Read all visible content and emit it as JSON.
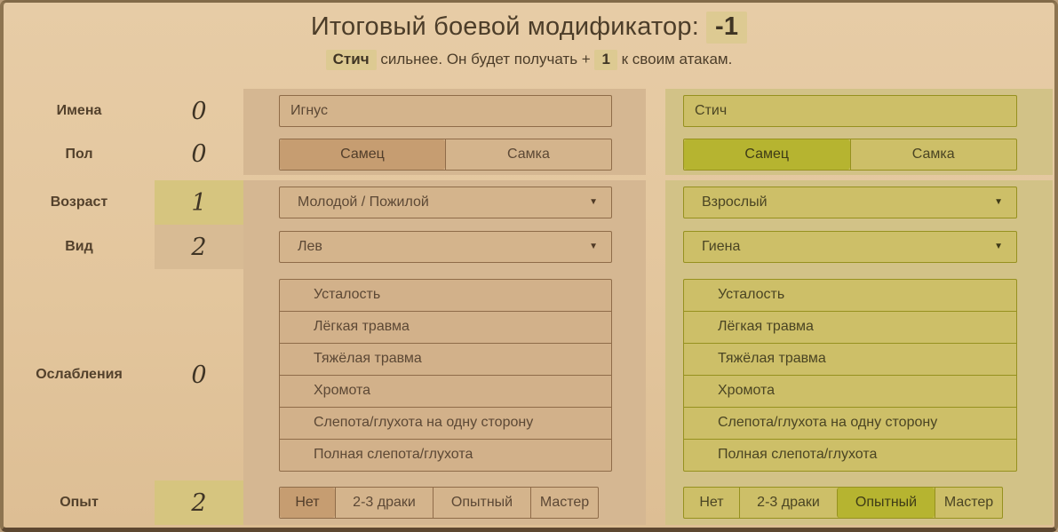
{
  "theme": {
    "left_accent": "#c69d71",
    "right_accent": "#b6b430",
    "highlight_badge": "#ddca92",
    "left_panel": "#d5b792",
    "right_panel": "#d2c287",
    "score_highlight_left": "#d8bb94",
    "score_highlight_right": "#d6c57f"
  },
  "header": {
    "title": "Итоговый боевой модификатор:",
    "total_modifier": "-1",
    "winner_name": "Стич",
    "summary_mid": " сильнее. Он будет получать + ",
    "bonus_value": "1",
    "summary_tail": " к своим атакам."
  },
  "categories": {
    "names": {
      "label": "Имена",
      "score": "0"
    },
    "gender": {
      "label": "Пол",
      "score": "0"
    },
    "age": {
      "label": "Возраст",
      "score": "1"
    },
    "species": {
      "label": "Вид",
      "score": "2"
    },
    "weaknesses": {
      "label": "Ослабления",
      "score": "0"
    },
    "experience": {
      "label": "Опыт",
      "score": "2"
    }
  },
  "options": {
    "gender": [
      "Самец",
      "Самка"
    ],
    "weaknesses": [
      "Усталость",
      "Лёгкая травма",
      "Тяжёлая травма",
      "Хромота",
      "Слепота/глухота на одну сторону",
      "Полная слепота/глухота"
    ],
    "experience": [
      "Нет",
      "2-3 драки",
      "Опытный",
      "Мастер"
    ]
  },
  "icons": {
    "dropdown_caret": "▼"
  },
  "left_character": {
    "name": "Игнус",
    "gender_selected": "Самец",
    "age_value": "Молодой / Пожилой",
    "species_value": "Лев",
    "experience_selected": "Нет"
  },
  "right_character": {
    "name": "Стич",
    "gender_selected": "Самец",
    "age_value": "Взрослый",
    "species_value": "Гиена",
    "experience_selected": "Опытный"
  }
}
